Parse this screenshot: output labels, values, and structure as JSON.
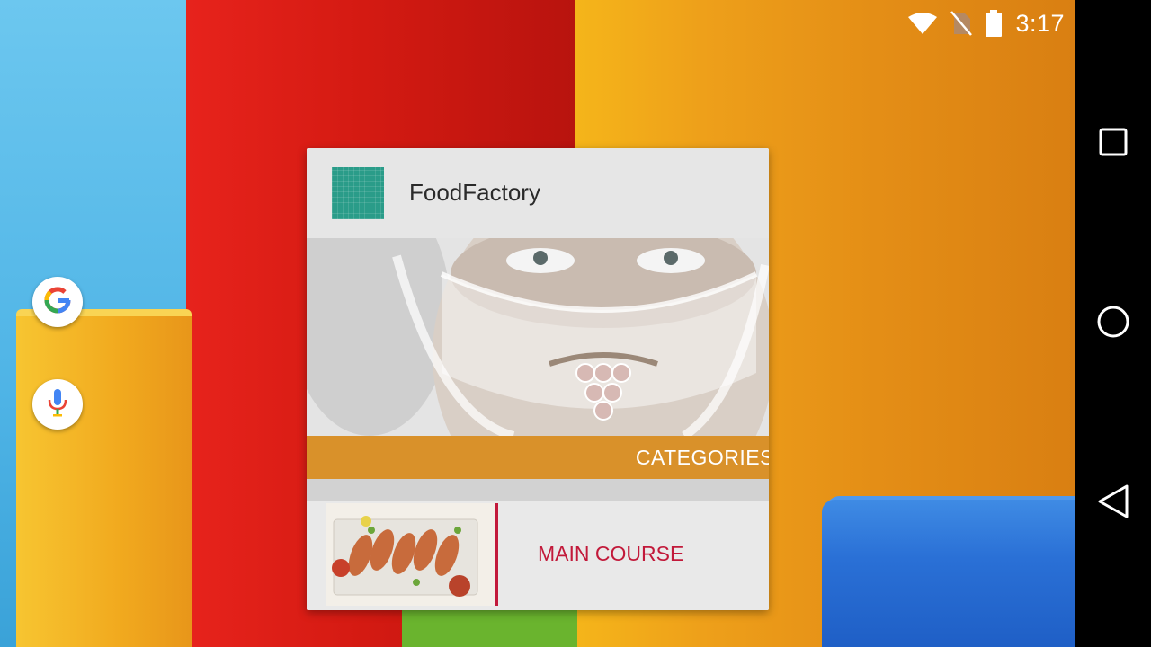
{
  "status_bar": {
    "time": "3:17",
    "icons": [
      "wifi-icon",
      "no-sim-icon",
      "battery-icon"
    ]
  },
  "nav_bar": {
    "buttons": [
      "recents-button",
      "home-button",
      "back-button"
    ]
  },
  "home_shortcuts": [
    "google-search-icon",
    "voice-search-icon"
  ],
  "widget": {
    "app_name": "FoodFactory",
    "hero_image": "chef-portrait",
    "category_label": "CATEGORIES",
    "list_items": [
      {
        "label": "MAIN COURSE",
        "thumbnail": "food-platter"
      }
    ],
    "colors": {
      "app_icon": "#2a9c89",
      "category_bar": "#d9912a",
      "accent": "#c2193a"
    }
  }
}
